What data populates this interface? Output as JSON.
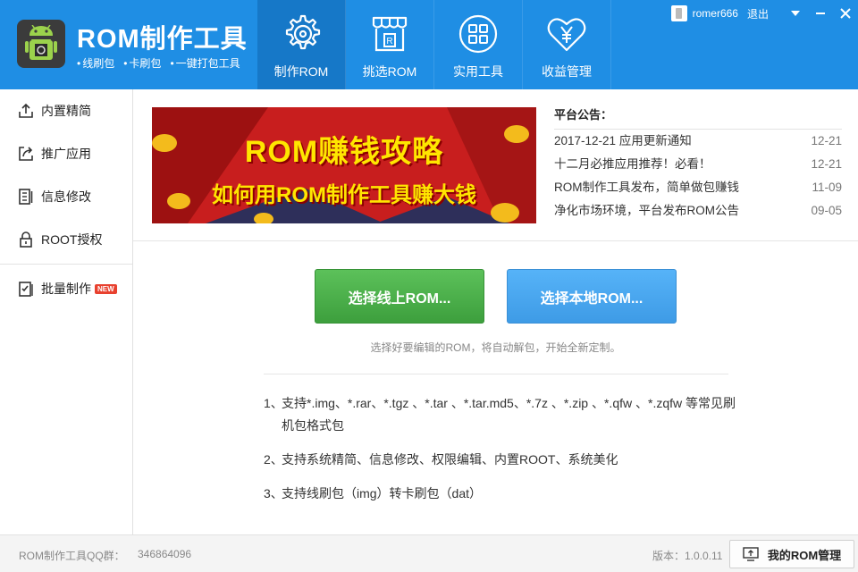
{
  "header": {
    "title": "ROM制作工具",
    "subtitle_items": [
      "线刷包",
      "卡刷包",
      "一键打包工具"
    ],
    "logo_icon": "android-rom-logo-icon",
    "accent_color": "#1f8ee4"
  },
  "nav": {
    "tabs": [
      {
        "label": "制作ROM",
        "icon": "gear-disc-icon",
        "active": true
      },
      {
        "label": "挑选ROM",
        "icon": "store-icon",
        "active": false
      },
      {
        "label": "实用工具",
        "icon": "grid-apps-icon",
        "active": false
      },
      {
        "label": "收益管理",
        "icon": "heart-yen-icon",
        "active": false
      }
    ]
  },
  "user": {
    "name": "romer666",
    "logout_label": "退出"
  },
  "sidebar": {
    "items": [
      {
        "label": "内置精简",
        "icon": "upload-box-icon"
      },
      {
        "label": "推广应用",
        "icon": "share-box-icon"
      },
      {
        "label": "信息修改",
        "icon": "document-edit-icon"
      },
      {
        "label": "ROOT授权",
        "icon": "lock-icon"
      },
      {
        "label": "批量制作",
        "icon": "checklist-icon",
        "badge": "NEW"
      }
    ]
  },
  "banner": {
    "line1": "ROM赚钱攻略",
    "line2": "如何用ROM制作工具赚大钱"
  },
  "notice": {
    "title": "平台公告：",
    "items": [
      {
        "text": "2017-12-21 应用更新通知",
        "date": "12-21"
      },
      {
        "text": "十二月必推应用推荐！必看！",
        "date": "12-21"
      },
      {
        "text": "ROM制作工具发布，简单做包赚钱",
        "date": "11-09"
      },
      {
        "text": "净化市场环境，平台发布ROM公告",
        "date": "09-05"
      }
    ]
  },
  "actions": {
    "online_label": "选择线上ROM...",
    "local_label": "选择本地ROM...",
    "hint": "选择好要编辑的ROM，将自动解包，开始全新定制。"
  },
  "features": [
    {
      "num": "1、",
      "text": "支持*.img、*.rar、*.tgz 、*.tar 、*.tar.md5、*.7z 、*.zip 、*.qfw 、*.zqfw 等常见刷机包格式包"
    },
    {
      "num": "2、",
      "text": "支持系统精简、信息修改、权限编辑、内置ROOT、系统美化"
    },
    {
      "num": "3、",
      "text": "支持线刷包（img）转卡刷包（dat）"
    }
  ],
  "footer": {
    "qq_label": "ROM制作工具QQ群：",
    "qq_value": "346864096",
    "version": "版本：1.0.0.11",
    "my_rom_label": "我的ROM管理"
  }
}
